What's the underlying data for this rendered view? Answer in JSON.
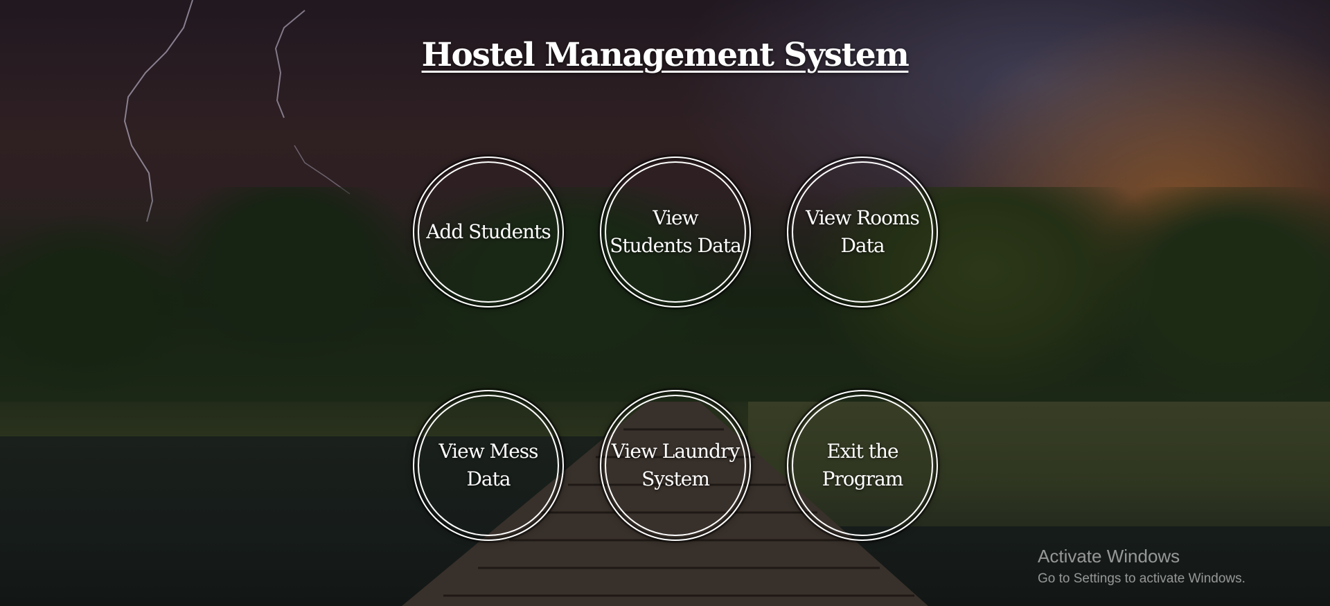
{
  "page": {
    "title": "Hostel Management System"
  },
  "menu": {
    "buttons": [
      {
        "id": "add-students",
        "label": "Add Students"
      },
      {
        "id": "view-students-data",
        "label": "View Students Data"
      },
      {
        "id": "view-rooms-data",
        "label": "View Rooms Data"
      },
      {
        "id": "view-mess-data",
        "label": "View Mess Data"
      },
      {
        "id": "view-laundry-system",
        "label": "View Laundry System"
      },
      {
        "id": "exit-the-program",
        "label": "Exit the Program"
      }
    ]
  },
  "os_watermark": {
    "title": "Activate Windows",
    "subtitle": "Go to Settings to activate Windows."
  },
  "colors": {
    "text": "#ffffff",
    "circle_border": "#ffffff"
  }
}
